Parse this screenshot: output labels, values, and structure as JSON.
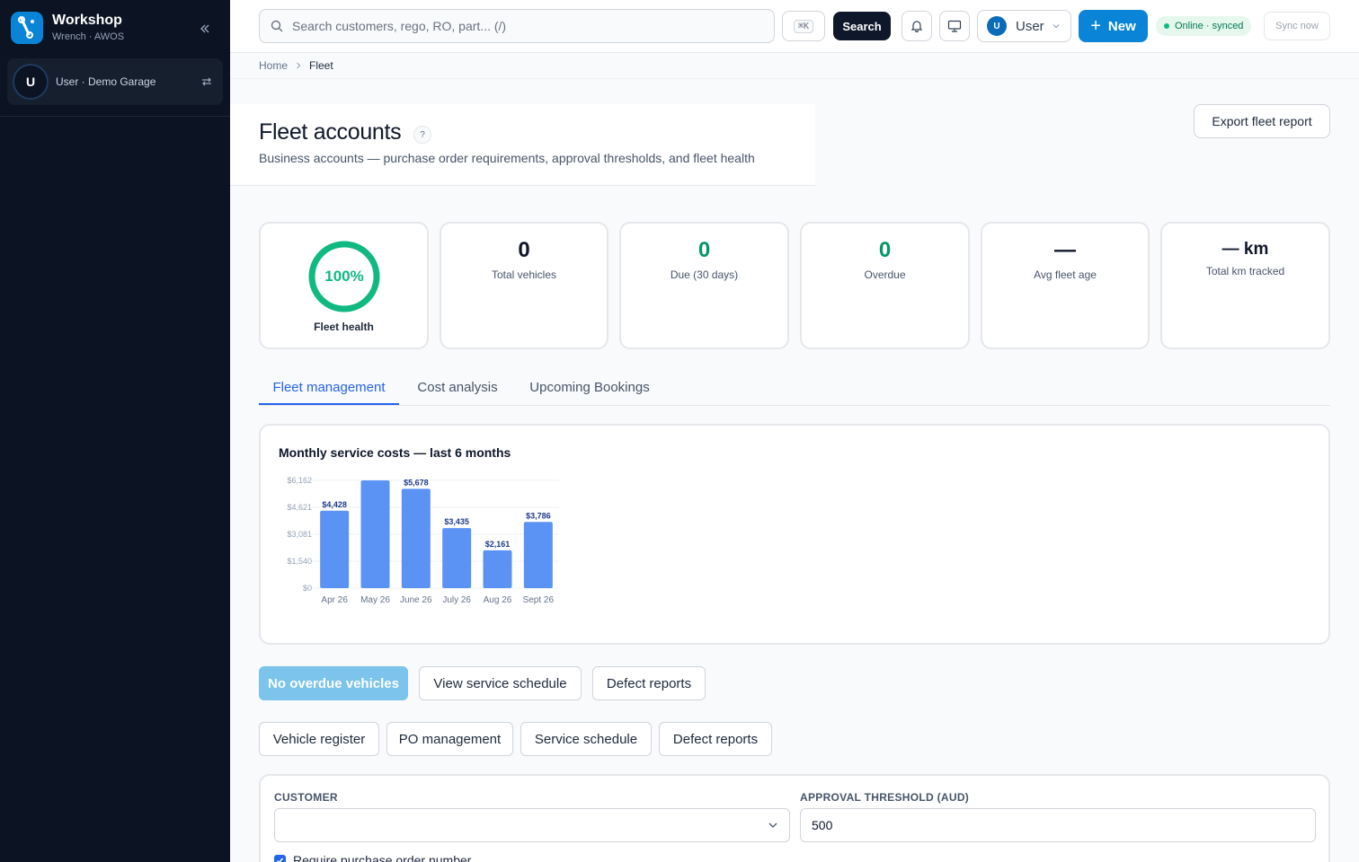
{
  "sidebar": {
    "brand_name": "Workshop",
    "brand_sub": "Wrench · AWOS",
    "user_initial": "U",
    "user_label": "User · Demo Garage"
  },
  "topbar": {
    "search_placeholder": "Search customers, rego, RO, part... (/)",
    "shortcut": "⌘K",
    "search_label": "Search",
    "user_initial": "U",
    "user_name": "User",
    "new_label": "New",
    "status_text": "Online · synced",
    "sync_label": "Sync now"
  },
  "breadcrumb": {
    "home": "Home",
    "current": "Fleet"
  },
  "header": {
    "title": "Fleet accounts",
    "help": "?",
    "subtitle": "Business accounts — purchase order requirements, approval thresholds, and fleet health",
    "export_label": "Export fleet report"
  },
  "kpis": {
    "health_value": "100%",
    "health_fraction": 1.0,
    "health_label": "Fleet health",
    "total_vehicles": "0",
    "total_vehicles_label": "Total vehicles",
    "due": "0",
    "due_label": "Due (30 days)",
    "overdue": "0",
    "overdue_label": "Overdue",
    "avg_age": "—",
    "avg_age_label": "Avg fleet age",
    "total_km": "— km",
    "total_km_label": "Total km tracked"
  },
  "tabs": [
    "Fleet management",
    "Cost analysis",
    "Upcoming Bookings"
  ],
  "active_tab": 0,
  "chart_data": {
    "type": "bar",
    "title": "Monthly service costs — last 6 months",
    "categories": [
      "Apr 26",
      "May 26",
      "June 26",
      "July 26",
      "Aug 26",
      "Sept 26"
    ],
    "values": [
      4428,
      6162,
      5678,
      3435,
      2161,
      3786
    ],
    "data_labels": [
      "$4,428",
      "",
      "$5,678",
      "$3,435",
      "$2,161",
      "$3,786"
    ],
    "y_ticks": [
      0,
      1540,
      3081,
      4621,
      6162
    ],
    "y_tick_labels": [
      "$0",
      "$1,540",
      "$3,081",
      "$4,621",
      "$6,162"
    ],
    "ylim": [
      0,
      6162
    ],
    "grid": true,
    "color": "#5b93f5"
  },
  "actions_row1": {
    "overdue_label": "No overdue vehicles",
    "schedule_label": "View service schedule",
    "defects_label": "Defect reports"
  },
  "actions_row2": {
    "register_label": "Vehicle register",
    "po_label": "PO management",
    "schedule_label": "Service schedule",
    "defects_label": "Defect reports"
  },
  "form": {
    "customer_label": "CUSTOMER",
    "customer_value": "",
    "threshold_label": "APPROVAL THRESHOLD (AUD)",
    "threshold_value": "500",
    "require_po_label": "Require purchase order number",
    "require_po_checked": true
  }
}
